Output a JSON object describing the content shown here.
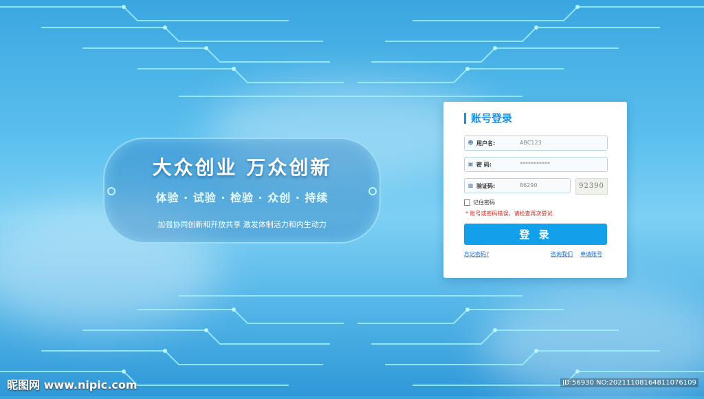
{
  "banner": {
    "headline": "大众创业 万众创新",
    "subline": "体验 · 试验 · 检验 · 众创 · 持续",
    "tagline": "加强协同创新和开放共享   激发体制活力和内生动力"
  },
  "login": {
    "title": "账号登录",
    "username": {
      "label": "用户名:",
      "value": "ABC123",
      "icon": "user-icon"
    },
    "password": {
      "label": "密   码:",
      "value": "***********",
      "icon": "lock-icon"
    },
    "captcha": {
      "label": "验证码:",
      "value": "86290",
      "icon": "shield-icon",
      "image_text": "92390"
    },
    "remember_label": "记住密码",
    "error": "* 账号或密码错误，请检查再次尝试.",
    "submit_label": "登 录",
    "forgot_link": "忘记密码?",
    "consult_link": "咨询我们",
    "register_link": "申请账号"
  },
  "watermark": {
    "left": "昵图网 www.nipic.com",
    "right": "ID:56930 NO:20211108164811076109"
  },
  "colors": {
    "accent": "#12a0ea",
    "error": "#e2231a",
    "title": "#1b8fe0"
  }
}
